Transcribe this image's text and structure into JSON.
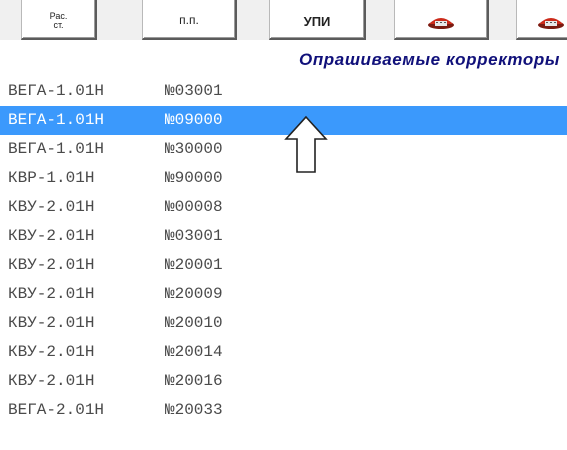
{
  "toolbar": {
    "buttons": [
      {
        "label": "Рас.\nст.",
        "kind": "text-small"
      },
      {
        "label": "п.п.",
        "kind": "text"
      },
      {
        "label": "УПИ",
        "kind": "text-bold"
      },
      {
        "label": "",
        "kind": "phone-icon",
        "icon": "phone-icon"
      },
      {
        "label": "",
        "kind": "phone-icon",
        "icon": "phone-icon"
      }
    ]
  },
  "list": {
    "title": "Опрашиваемые корректоры",
    "selected_index": 1,
    "items": [
      {
        "model": "ВЕГА-1.01Н",
        "serial": "№03001"
      },
      {
        "model": "ВЕГА-1.01Н",
        "serial": "№09000"
      },
      {
        "model": "ВЕГА-1.01Н",
        "serial": "№30000"
      },
      {
        "model": "КВР-1.01Н",
        "serial": "№90000"
      },
      {
        "model": "КВУ-2.01Н",
        "serial": "№00008"
      },
      {
        "model": "КВУ-2.01Н",
        "serial": "№03001"
      },
      {
        "model": "КВУ-2.01Н",
        "serial": "№20001"
      },
      {
        "model": "КВУ-2.01Н",
        "serial": "№20009"
      },
      {
        "model": "КВУ-2.01Н",
        "serial": "№20010"
      },
      {
        "model": "КВУ-2.01Н",
        "serial": "№20014"
      },
      {
        "model": "КВУ-2.01Н",
        "serial": "№20016"
      },
      {
        "model": "ВЕГА-2.01Н",
        "serial": "№20033"
      }
    ]
  },
  "colors": {
    "selection": "#3b99fc",
    "title": "#10107a",
    "row_text": "#4a4a4a",
    "phone_red": "#cc2a1a"
  },
  "cursor": {
    "icon": "up-arrow-cursor-icon"
  }
}
